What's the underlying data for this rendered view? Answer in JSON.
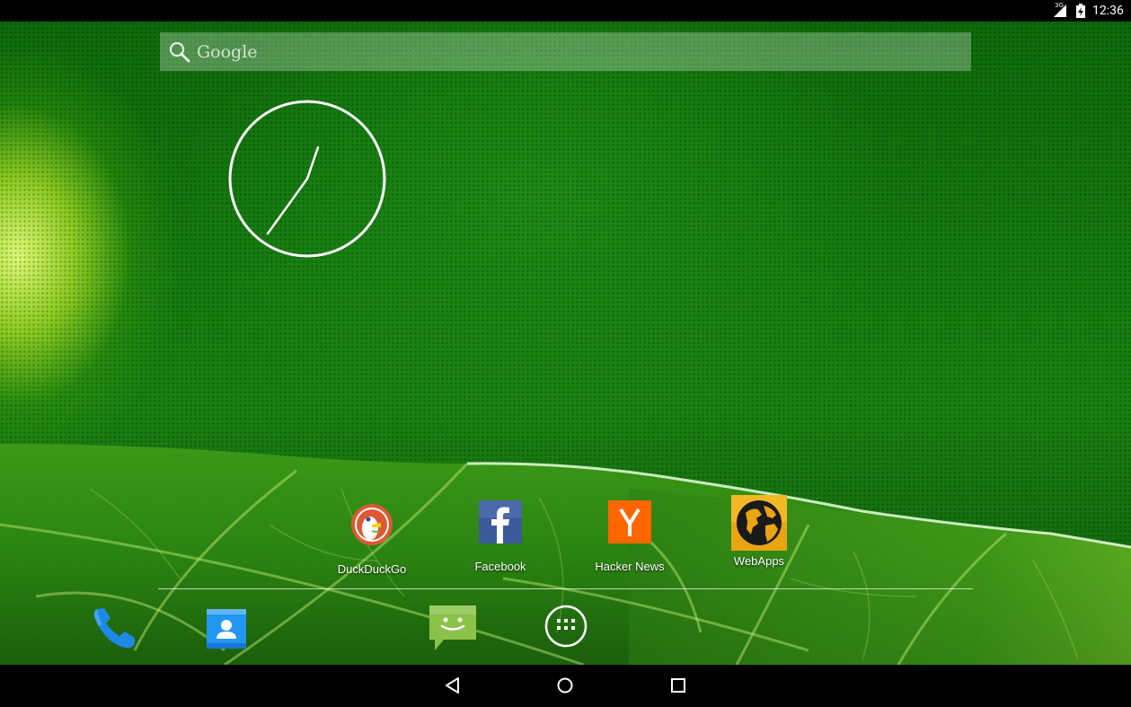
{
  "status_bar": {
    "network_type": "3G",
    "time": "12:36",
    "icons": [
      "signal-icon",
      "battery-icon"
    ]
  },
  "search_widget": {
    "label": "Google",
    "icon": "search-icon"
  },
  "clock_widget": {
    "type": "analog-clock",
    "time": "12:36"
  },
  "home_apps": [
    {
      "label": "DuckDuckGo",
      "icon": "duckduckgo-icon"
    },
    {
      "label": "Facebook",
      "icon": "facebook-icon"
    },
    {
      "label": "Hacker News",
      "icon": "hacker-news-icon"
    },
    {
      "label": "WebApps",
      "icon": "webapps-icon"
    }
  ],
  "dock": [
    {
      "name": "Phone",
      "icon": "phone-icon"
    },
    {
      "name": "Contacts",
      "icon": "contacts-icon"
    },
    {
      "name": "Messaging",
      "icon": "messaging-icon"
    },
    {
      "name": "All apps",
      "icon": "app-drawer-icon"
    }
  ],
  "nav_bar": {
    "buttons": [
      "back-icon",
      "home-icon",
      "recents-icon"
    ]
  },
  "colors": {
    "wallpaper_green": "#167a10",
    "facebook_blue": "#3b5998",
    "hacker_news_orange": "#ff6600",
    "phone_blue": "#1e88e5",
    "messaging_green": "#8bc34a"
  }
}
